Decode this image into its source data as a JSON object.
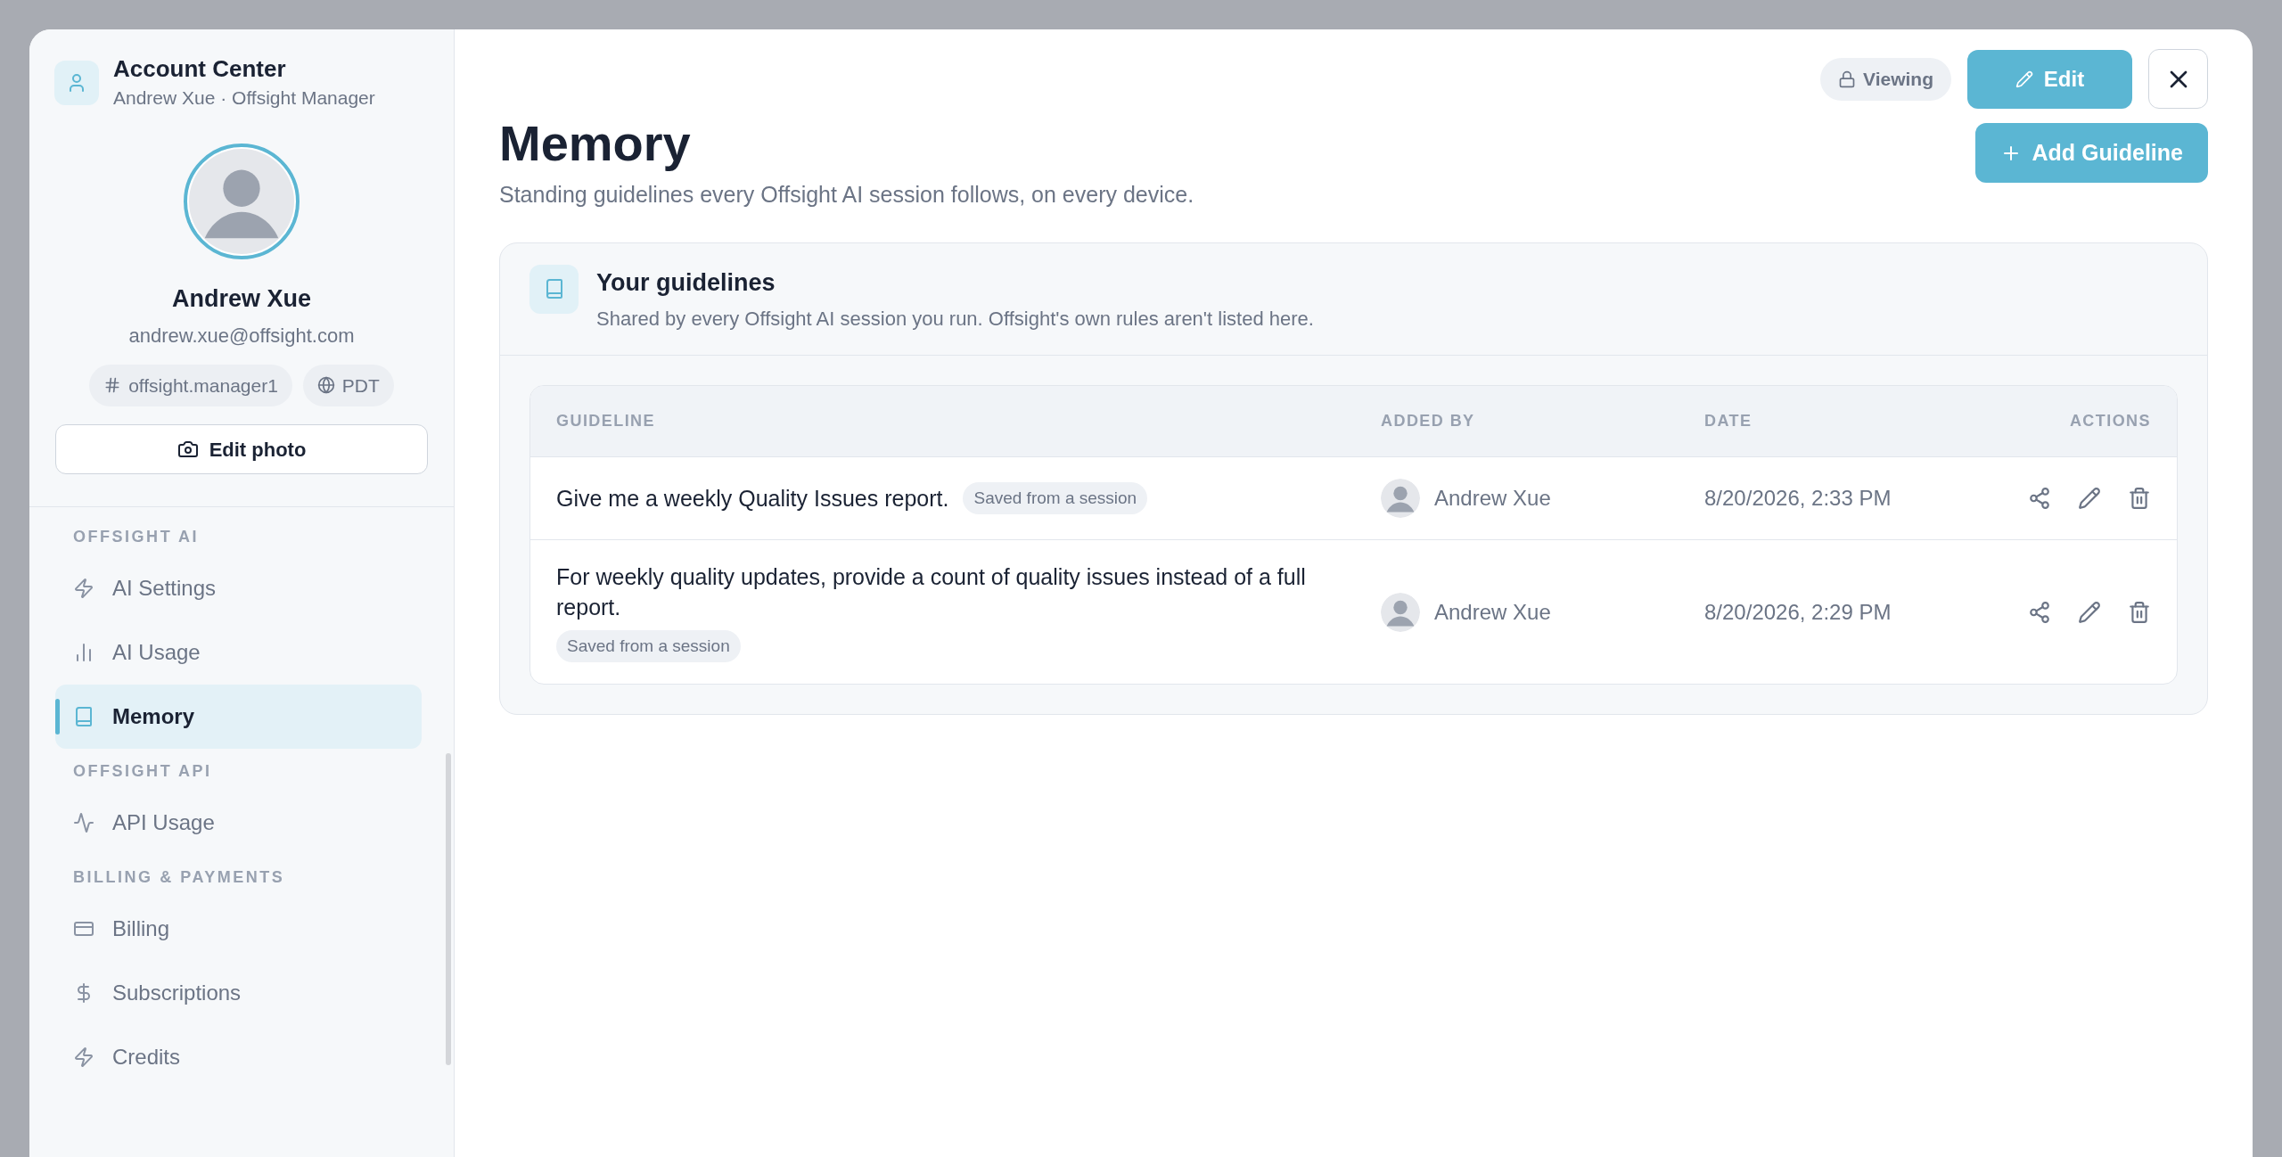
{
  "sidebar": {
    "title": "Account Center",
    "subtitle": "Andrew Xue · Offsight Manager",
    "profile": {
      "name": "Andrew Xue",
      "email": "andrew.xue@offsight.com",
      "handle": "offsight.manager1",
      "timezone": "PDT",
      "edit_photo": "Edit photo"
    },
    "sections": [
      {
        "label": "OFFSIGHT AI",
        "items": [
          {
            "label": "AI Settings",
            "kind": "bolt",
            "selected": false
          },
          {
            "label": "AI Usage",
            "kind": "bars",
            "selected": false
          },
          {
            "label": "Memory",
            "kind": "book",
            "selected": true
          }
        ]
      },
      {
        "label": "OFFSIGHT API",
        "items": [
          {
            "label": "API Usage",
            "kind": "pulse",
            "selected": false
          }
        ]
      },
      {
        "label": "BILLING & PAYMENTS",
        "items": [
          {
            "label": "Billing",
            "kind": "card",
            "selected": false
          },
          {
            "label": "Subscriptions",
            "kind": "dollar",
            "selected": false
          },
          {
            "label": "Credits",
            "kind": "bolt",
            "selected": false
          }
        ]
      }
    ]
  },
  "toolbar": {
    "mode": "Viewing",
    "edit": "Edit"
  },
  "page": {
    "title": "Memory",
    "subtitle": "Standing guidelines every Offsight AI session follows, on every device.",
    "add_button": "Add Guideline"
  },
  "card": {
    "title": "Your guidelines",
    "subtitle": "Shared by every Offsight AI session you run. Offsight's own rules aren't listed here.",
    "table": {
      "columns": [
        "GUIDELINE",
        "ADDED BY",
        "DATE",
        "ACTIONS"
      ],
      "rows": [
        {
          "guideline": "Give me a weekly Quality Issues report.",
          "tag": "Saved from a session",
          "added_by": "Andrew Xue",
          "date": "8/20/2026, 2:33 PM"
        },
        {
          "guideline": "For weekly quality updates, provide a count of quality issues instead of a full report.",
          "tag": "Saved from a session",
          "added_by": "Andrew Xue",
          "date": "8/20/2026, 2:29 PM"
        }
      ]
    }
  }
}
